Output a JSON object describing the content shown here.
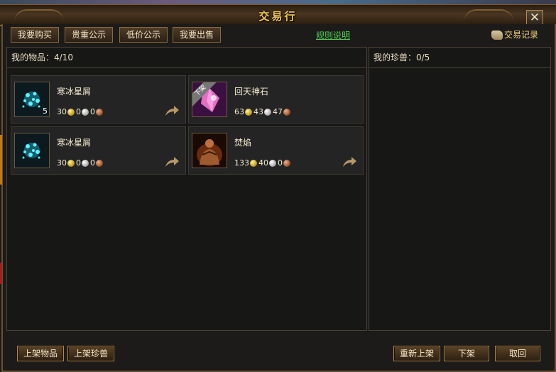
{
  "window": {
    "title": "交易行",
    "close_label": "✕"
  },
  "tabs": [
    {
      "label": "我要购买"
    },
    {
      "label": "贵重公示"
    },
    {
      "label": "低价公示"
    },
    {
      "label": "我要出售"
    }
  ],
  "links": {
    "rules": "规则说明",
    "trade_log": "交易记录"
  },
  "items_panel": {
    "header": "我的物品：4/10",
    "items": [
      {
        "name": "寒冰星屑",
        "gold": "30",
        "silver": "0",
        "copper": "0",
        "count": "5",
        "icon": "ice-crystal-icon"
      },
      {
        "name": "回天神石",
        "gold": "63",
        "silver": "43",
        "copper": "47",
        "badge": "下架",
        "icon": "pink-gem-icon"
      },
      {
        "name": "寒冰星屑",
        "gold": "30",
        "silver": "0",
        "copper": "0",
        "icon": "ice-crystal-icon"
      },
      {
        "name": "焚焰",
        "gold": "133",
        "silver": "40",
        "copper": "0",
        "icon": "flame-warrior-icon"
      }
    ]
  },
  "pets_panel": {
    "header": "我的珍兽：0/5"
  },
  "buttons": {
    "list_item": "上架物品",
    "list_pet": "上架珍兽",
    "relist": "重新上架",
    "delist": "下架",
    "cancel": "取回"
  },
  "colors": {
    "title_gold": "#f2c95a",
    "link_green": "#4fd14f",
    "frame_brown": "#6a5030"
  }
}
